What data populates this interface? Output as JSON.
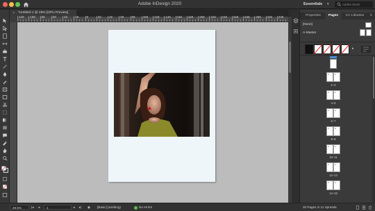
{
  "window": {
    "title": "Adobe InDesign 2020",
    "workspace": "Essentials",
    "search_placeholder": "Adobe Stock"
  },
  "document_tab": {
    "label": "*Untitled-1 @ 49% [GPU Preview]"
  },
  "ruler": {
    "h_labels": [
      "120",
      "100",
      "80",
      "60",
      "40",
      "20",
      "0",
      "20",
      "40",
      "60",
      "80",
      "100",
      "120",
      "140",
      "160",
      "180",
      "200",
      "220",
      "240",
      "260",
      "280",
      "300",
      "320",
      "340"
    ]
  },
  "status": {
    "zoom": "49.5%",
    "page": "1",
    "preflight_profile": "[Basic] (working)",
    "errors": "No errors"
  },
  "panel": {
    "tabs": [
      "Properties",
      "Pages",
      "CC Libraries"
    ],
    "active_tab": "Pages",
    "none_master": "[None]",
    "a_master": "A-Master",
    "swatch_colors": [
      "#111111",
      "#ffffff",
      "#ffffff",
      "#ffffff",
      "#ffffff"
    ],
    "first_page_label": "1",
    "spreads": [
      "2–3",
      "4–5",
      "6–7",
      "8–9",
      "10–11",
      "12–13",
      "14–15"
    ],
    "footer": "20 Pages in 11 Spreads"
  },
  "colors": {
    "accent": "#4a90d9",
    "page_bg": "#eef6fa",
    "canvas_bg": "#bcbcbc",
    "no_errors": "#5dbb4d"
  }
}
